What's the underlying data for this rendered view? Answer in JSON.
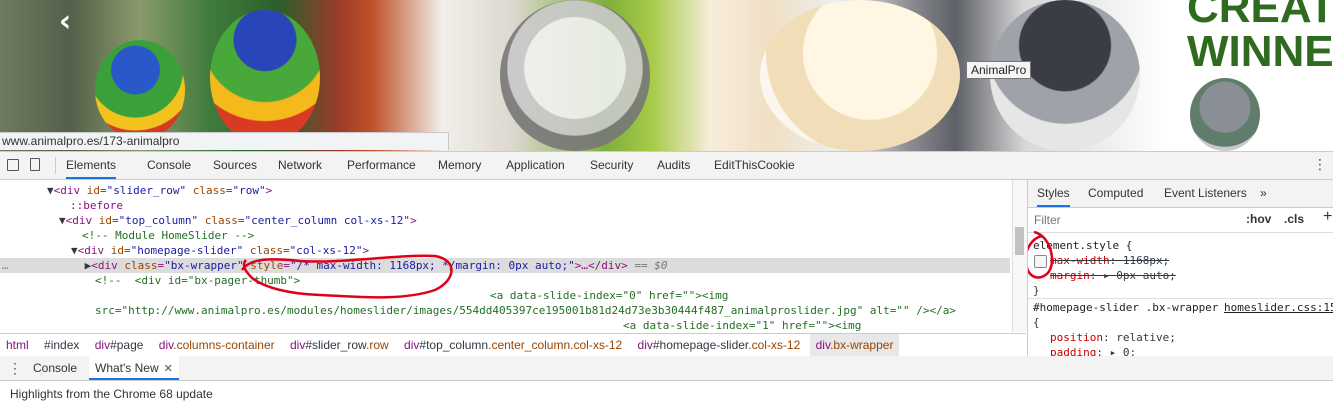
{
  "page": {
    "tooltip": "AnimalPro",
    "promo_text": "CREAT\nWINNE",
    "promo_line1": "CREAT",
    "promo_line2": "WINNE",
    "prev_arrow": "‹",
    "status_url": "www.animalpro.es/173-animalpro"
  },
  "devtools": {
    "tabs": [
      "Elements",
      "Console",
      "Sources",
      "Network",
      "Performance",
      "Memory",
      "Application",
      "Security",
      "Audits",
      "EditThisCookie"
    ],
    "active_tab": "Elements",
    "more_icon": "⋮",
    "dom": {
      "l1": {
        "tag_open": "<div ",
        "a1": "id",
        "v1": "\"slider_row\"",
        "a2": "class",
        "v2": "\"row\"",
        "tag_close": ">"
      },
      "l2": "::before",
      "l3": {
        "tag_open": "<div ",
        "a1": "id",
        "v1": "\"top_column\"",
        "a2": "class",
        "v2": "\"center_column col-xs-12\"",
        "tag_close": ">"
      },
      "l4": "<!-- Module HomeSlider -->",
      "l5": {
        "tag_open": "<div ",
        "a1": "id",
        "v1": "\"homepage-slider\"",
        "a2": "class",
        "v2": "\"col-xs-12\"",
        "tag_close": ">"
      },
      "l6": {
        "tag_open": "<div ",
        "a1": "class",
        "v1": "\"bx-wrapper\"",
        "a2": "style",
        "v2": "\"/* max-width: 1168px; */margin: 0px auto;\"",
        "tag_close": ">…</div>",
        "eq": " == $0"
      },
      "l7": "<!--  <div id=\"bx-pager-thumb\">",
      "l8": "<a data-slide-index=\"0\" href=\"\"><img",
      "l9": "src=\"http://www.animalpro.es/modules/homeslider/images/554dd405397ce195001b81d24d73e3b30444f487_animalproslider.jpg\" alt=\"\" /></a>",
      "l10": "<a data-slide-index=\"1\" href=\"\"><img"
    },
    "breadcrumb": [
      {
        "tag": "html",
        "rest": "",
        "cls": ""
      },
      {
        "tag": "",
        "rest": "#index",
        "cls": ""
      },
      {
        "tag": "div",
        "rest": "#page",
        "cls": ""
      },
      {
        "tag": "div",
        "rest": "",
        "cls": ".columns-container"
      },
      {
        "tag": "div",
        "rest": "#slider_row",
        "cls": ".row"
      },
      {
        "tag": "div",
        "rest": "#top_column",
        "cls": ".center_column.col-xs-12"
      },
      {
        "tag": "div",
        "rest": "#homepage-slider",
        "cls": ".col-xs-12"
      },
      {
        "tag": "div",
        "rest": "",
        "cls": ".bx-wrapper"
      }
    ],
    "styles": {
      "tabs": [
        "Styles",
        "Computed",
        "Event Listeners"
      ],
      "more": "»",
      "filter_placeholder": "Filter",
      "hov": ":hov",
      "cls": ".cls",
      "add": "+",
      "element_style": "element.style {",
      "prop1_name": "max-width",
      "prop1_value": "1168px;",
      "prop2_name": "margin",
      "prop2_value": "0px auto;",
      "close_brace": "}",
      "rule2_selector": "#homepage-slider .bx-wrapper",
      "rule2_source": "homeslider.css:15",
      "open_brace": "{",
      "r2_prop1_name": "position",
      "r2_prop1_value": "relative;",
      "r2_prop2_name": "padding",
      "r2_prop2_value": "0;"
    },
    "drawer": {
      "menu_icon": "⋮",
      "tabs": [
        "Console",
        "What's New"
      ],
      "active": "What's New",
      "close": "✕",
      "body_text": "Highlights from the Chrome 68 update"
    }
  },
  "colors": {
    "accent": "#1a73e8",
    "tag": "#881280",
    "attr": "#994500",
    "value": "#1a1aa6",
    "comment": "#236e25",
    "annotation": "#e0001b",
    "promo_green": "#2f6b1f"
  }
}
